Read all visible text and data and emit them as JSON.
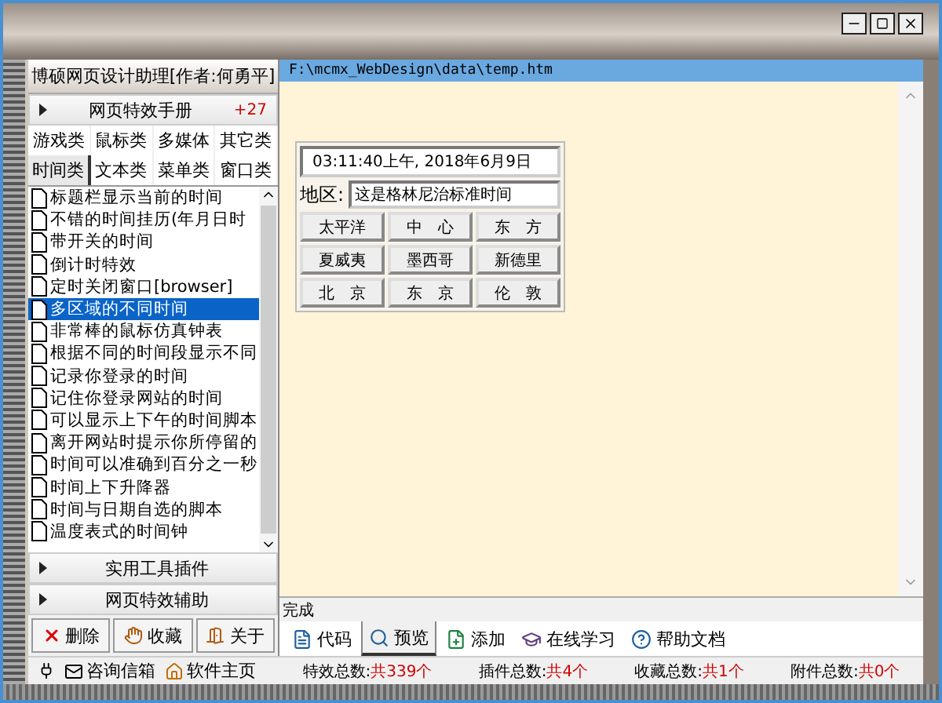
{
  "app_title": "博硕网页设计助理[作者:何勇平]",
  "sections_top": [
    {
      "label": "网页特效手册",
      "badge": "+27"
    }
  ],
  "categories": [
    {
      "label": "游戏类",
      "selected": false
    },
    {
      "label": "鼠标类",
      "selected": false
    },
    {
      "label": "多媒体",
      "selected": false
    },
    {
      "label": "其它类",
      "selected": false
    },
    {
      "label": "时间类",
      "selected": true
    },
    {
      "label": "文本类",
      "selected": false
    },
    {
      "label": "菜单类",
      "selected": false
    },
    {
      "label": "窗口类",
      "selected": false
    }
  ],
  "effects": [
    {
      "label": "标题栏显示当前的时间",
      "selected": false
    },
    {
      "label": "不错的时间挂历(年月日时",
      "selected": false
    },
    {
      "label": "带开关的时间",
      "selected": false
    },
    {
      "label": "倒计时特效",
      "selected": false
    },
    {
      "label": "定时关闭窗口[browser]",
      "selected": false
    },
    {
      "label": "多区域的不同时间",
      "selected": true
    },
    {
      "label": "非常棒的鼠标仿真钟表",
      "selected": false
    },
    {
      "label": "根据不同的时间段显示不同",
      "selected": false
    },
    {
      "label": "记录你登录的时间",
      "selected": false
    },
    {
      "label": "记住你登录网站的时间",
      "selected": false
    },
    {
      "label": "可以显示上下午的时间脚本",
      "selected": false
    },
    {
      "label": "离开网站时提示你所停留的",
      "selected": false
    },
    {
      "label": "时间可以准确到百分之一秒",
      "selected": false
    },
    {
      "label": "时间上下升降器",
      "selected": false
    },
    {
      "label": "时间与日期自选的脚本",
      "selected": false
    },
    {
      "label": "温度表式的时间钟",
      "selected": false
    }
  ],
  "sections_bottom": [
    {
      "label": "实用工具插件"
    },
    {
      "label": "网页特效辅助"
    }
  ],
  "actions": [
    {
      "label": "删除",
      "kind": "delete"
    },
    {
      "label": "收藏",
      "kind": "favorite"
    },
    {
      "label": "关于",
      "kind": "about"
    }
  ],
  "links": [
    {
      "label": "咨询信箱",
      "kind": "mail"
    },
    {
      "label": "软件主页",
      "kind": "home"
    }
  ],
  "path": "F:\\mcmx_WebDesign\\data\\temp.htm",
  "preview": {
    "clock": "03:11:40上午, 2018年6月9日",
    "region_label": "地区:",
    "region_value": "这是格林尼治标准时间",
    "zones": [
      "太平洋",
      "中　心",
      "东　方",
      "夏威夷",
      "墨西哥",
      "新德里",
      "北　京",
      "东　京",
      "伦　敦"
    ]
  },
  "browser_status": "完成",
  "tabs": [
    {
      "label": "代码",
      "kind": "code",
      "selected": false
    },
    {
      "label": "预览",
      "kind": "preview",
      "selected": true
    },
    {
      "label": "添加",
      "kind": "add",
      "selected": false
    },
    {
      "label": "在线学习",
      "kind": "learn",
      "selected": false
    },
    {
      "label": "帮助文档",
      "kind": "help",
      "selected": false
    }
  ],
  "totals": [
    {
      "label": "特效总数:",
      "value": "共339个"
    },
    {
      "label": "插件总数:",
      "value": "共4个"
    },
    {
      "label": "收藏总数:",
      "value": "共1个"
    },
    {
      "label": "附件总数:",
      "value": "共0个"
    }
  ]
}
